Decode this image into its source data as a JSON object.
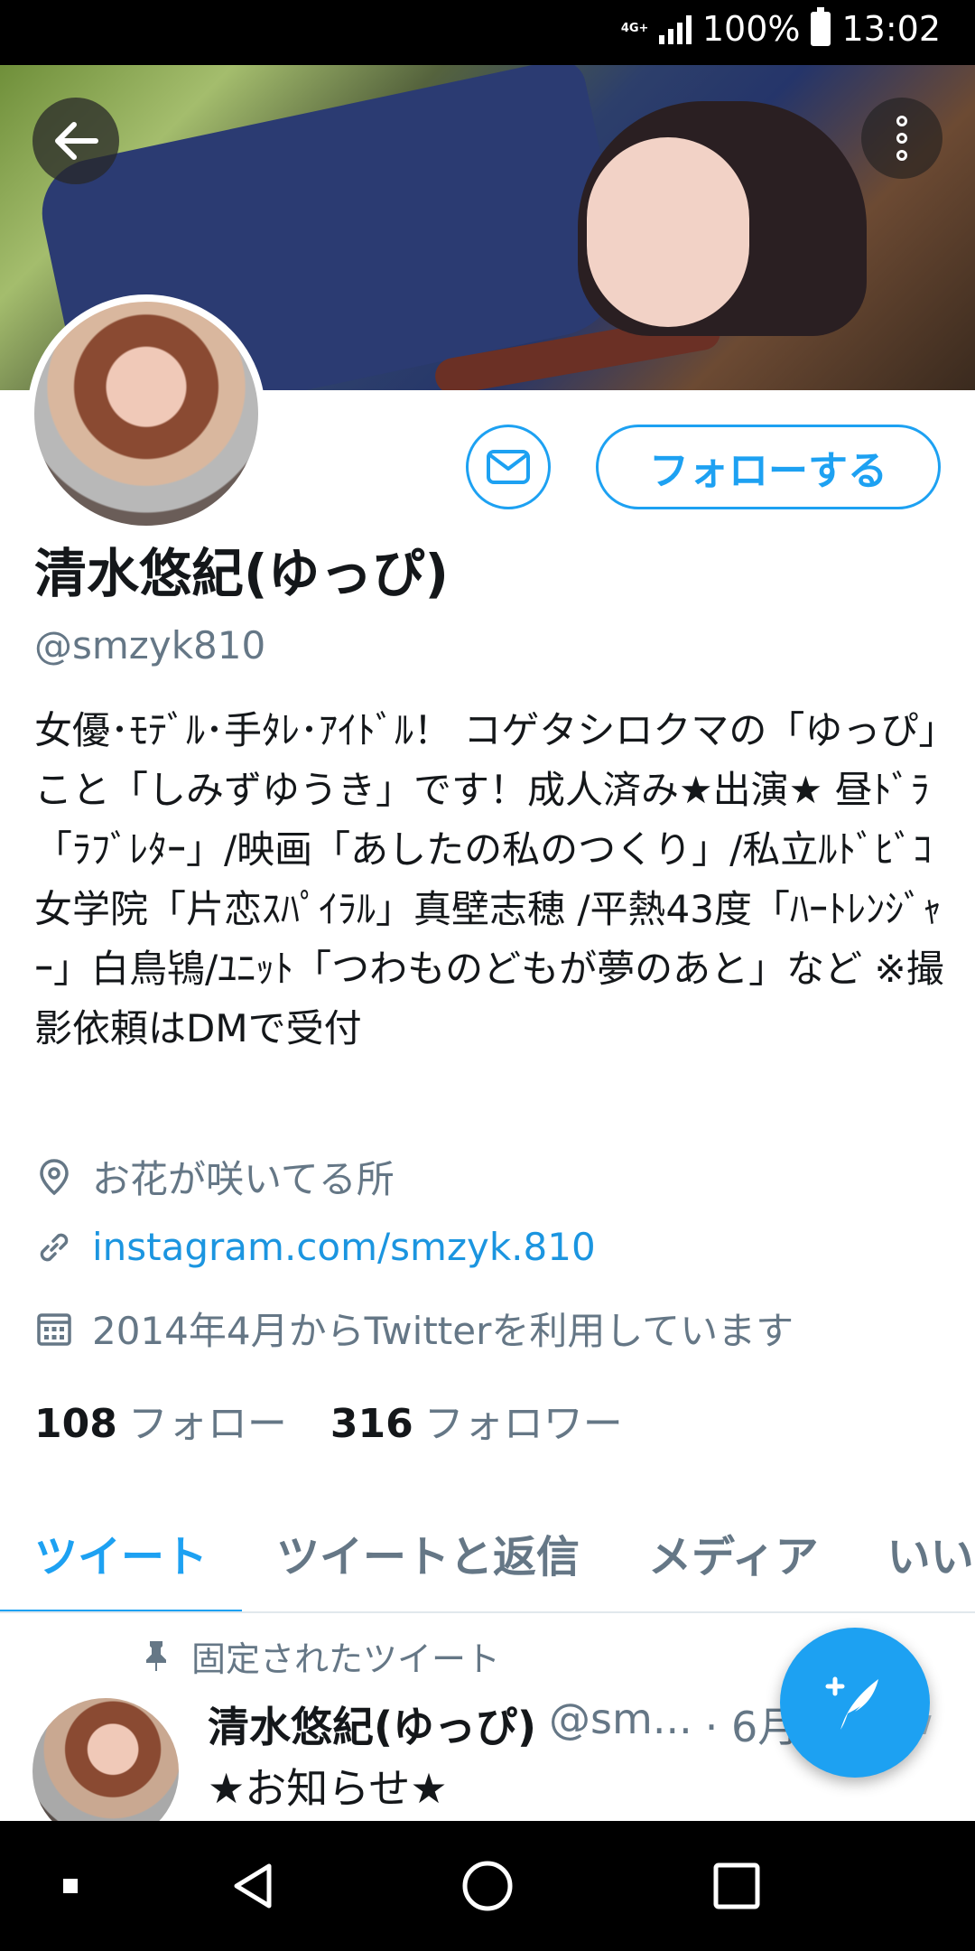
{
  "status_bar": {
    "network": "4G+",
    "battery": "100%",
    "time": "13:02"
  },
  "profile": {
    "name": "清水悠紀(ゆっぴ)",
    "handle": "@smzyk810",
    "follow_label": "フォローする",
    "bio": "女優･ﾓﾃﾞﾙ･手ﾀﾚ･ｱｲﾄﾞﾙ！ コゲタシロクマの「ゆっぴ」こと「しみずゆうき」です！成人済み★出演★ 昼ﾄﾞﾗ「ﾗﾌﾞﾚﾀｰ」/映画「あしたの私のつくり」/私立ﾙﾄﾞﾋﾞｺ女学院「片恋ｽﾊﾟｲﾗﾙ」真壁志穂 /平熱43度「ﾊｰﾄﾚﾝｼﾞｬｰ」白鳥鴇/ﾕﾆｯﾄ「つわものどもが夢のあと」など ※撮影依頼はDMで受付",
    "location": "お花が咲いてる所",
    "link": "instagram.com/smzyk.810",
    "joined": "2014年4月からTwitterを利用しています",
    "following_count": "108",
    "following_label": "フォロー",
    "followers_count": "316",
    "followers_label": "フォロワー"
  },
  "tabs": [
    {
      "label": "ツイート"
    },
    {
      "label": "ツイートと返信"
    },
    {
      "label": "メディア"
    },
    {
      "label": "いいね"
    }
  ],
  "pinned_tweet": {
    "pinned_label": "固定されたツイート",
    "author_name": "清水悠紀(ゆっぴ)",
    "author_handle": "@sm...",
    "date": "· 6月",
    "text": "★お知らせ★"
  },
  "colors": {
    "accent": "#1da1f2",
    "link": "#1b95e0",
    "muted": "#657786"
  },
  "icons": {
    "back": "arrow-left-icon",
    "more": "more-vertical-icon",
    "dm": "envelope-icon",
    "location": "map-pin-icon",
    "link": "link-icon",
    "date": "calendar-icon",
    "pin": "pin-icon",
    "compose": "compose-tweet-icon"
  }
}
